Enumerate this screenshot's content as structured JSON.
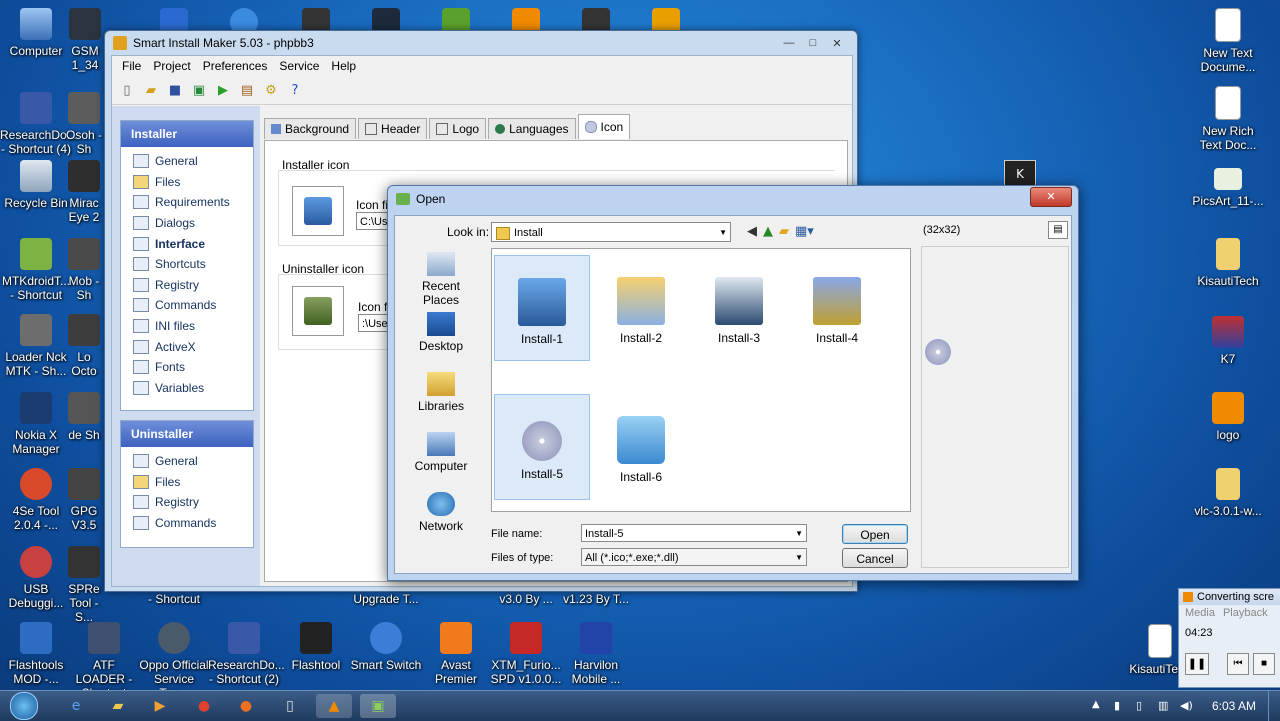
{
  "desktop": {
    "icons_left": [
      {
        "label": "Computer"
      },
      {
        "label": "GSM 1_34"
      },
      {
        "label": "ResearchDo... - Shortcut (4)"
      },
      {
        "label": "Osoh - Sh"
      },
      {
        "label": "Recycle Bin"
      },
      {
        "label": "Mirac Eye 2"
      },
      {
        "label": "MTKdroidT... - Shortcut"
      },
      {
        "label": "Mob - Sh"
      },
      {
        "label": "Loader Nck MTK - Sh..."
      },
      {
        "label": "Lo Octo"
      },
      {
        "label": "Nokia X Manager"
      },
      {
        "label": "de Sh"
      },
      {
        "label": "4Se Tool 2.0.4 -..."
      },
      {
        "label": "GPG V3.5"
      },
      {
        "label": "USB Debuggi..."
      },
      {
        "label": "SPRe Tool - S..."
      }
    ],
    "icons_bottom": [
      {
        "label": "Flashtools MOD -..."
      },
      {
        "label": "ATF LOADER - Shortcut"
      },
      {
        "label": "Oppo Official Service Too..."
      },
      {
        "label": "ResearchDo... - Shortcut (2)"
      },
      {
        "label": "Flashtool"
      },
      {
        "label": "Smart Switch"
      },
      {
        "label": "Avast Premier"
      },
      {
        "label": "XTM_Furio... SPD v1.0.0..."
      },
      {
        "label": "Harvilon Mobile ..."
      }
    ],
    "icons_bottom_row2": [
      {
        "label": "- Shortcut"
      },
      {
        "label": "Upgrade T..."
      },
      {
        "label": "v3.0 By ..."
      },
      {
        "label": "v1.23 By T..."
      }
    ],
    "icons_right": [
      {
        "label": "New Text Docume..."
      },
      {
        "label": "New Rich Text Doc..."
      },
      {
        "label": "PicsArt_11-..."
      },
      {
        "label": "KisautiTech"
      },
      {
        "label": "K7"
      },
      {
        "label": "logo"
      },
      {
        "label": "vlc-3.0.1-w..."
      },
      {
        "label": "KisautiTech"
      }
    ]
  },
  "main_window": {
    "title": "Smart Install Maker 5.03 - phpbb3",
    "menu": [
      "File",
      "Project",
      "Preferences",
      "Service",
      "Help"
    ],
    "installer_section": {
      "header": "Installer",
      "items": [
        "General",
        "Files",
        "Requirements",
        "Dialogs",
        "Interface",
        "Shortcuts",
        "Registry",
        "Commands",
        "INI files",
        "ActiveX",
        "Fonts",
        "Variables"
      ],
      "active_item": "Interface"
    },
    "uninstaller_section": {
      "header": "Uninstaller",
      "items": [
        "General",
        "Files",
        "Registry",
        "Commands"
      ]
    },
    "tabs": [
      {
        "label": "Background",
        "icon": "background-icon"
      },
      {
        "label": "Header",
        "icon": "header-icon"
      },
      {
        "label": "Logo",
        "icon": "logo-icon"
      },
      {
        "label": "Languages",
        "icon": "globe-icon"
      },
      {
        "label": "Icon",
        "icon": "disc-icon"
      }
    ],
    "active_tab": "Icon",
    "installer_icon_group": {
      "label": "Installer icon",
      "field_label": "Icon file",
      "field_value": "C:\\User"
    },
    "uninstaller_icon_group": {
      "label": "Uninstaller icon",
      "field_label": "Icon file",
      "field_value": ":\\Users"
    }
  },
  "open_dialog": {
    "title": "Open",
    "look_in_label": "Look in:",
    "look_in_value": "Install",
    "preview_size": "(32x32)",
    "places": [
      {
        "label": "Recent Places"
      },
      {
        "label": "Desktop"
      },
      {
        "label": "Libraries"
      },
      {
        "label": "Computer"
      },
      {
        "label": "Network"
      }
    ],
    "files": [
      {
        "label": "Install-1",
        "selected": true
      },
      {
        "label": "Install-2",
        "selected": false
      },
      {
        "label": "Install-3",
        "selected": false
      },
      {
        "label": "Install-4",
        "selected": false
      },
      {
        "label": "Install-5",
        "selected": true
      },
      {
        "label": "Install-6",
        "selected": false
      }
    ],
    "file_name_label": "File name:",
    "file_name_value": "Install-5",
    "file_type_label": "Files of type:",
    "file_type_value": "All (*.ico;*.exe;*.dll)",
    "open_label": "Open",
    "cancel_label": "Cancel"
  },
  "media_widget": {
    "title": "Converting scre",
    "menu": [
      "Media",
      "Playback"
    ],
    "time": "04:23"
  },
  "taskbar": {
    "clock": "6:03 AM"
  },
  "colors": {
    "desktop_blue": "#1a6fc4",
    "panel_header": "#3d62c0",
    "selection": "#dbe9f9"
  }
}
